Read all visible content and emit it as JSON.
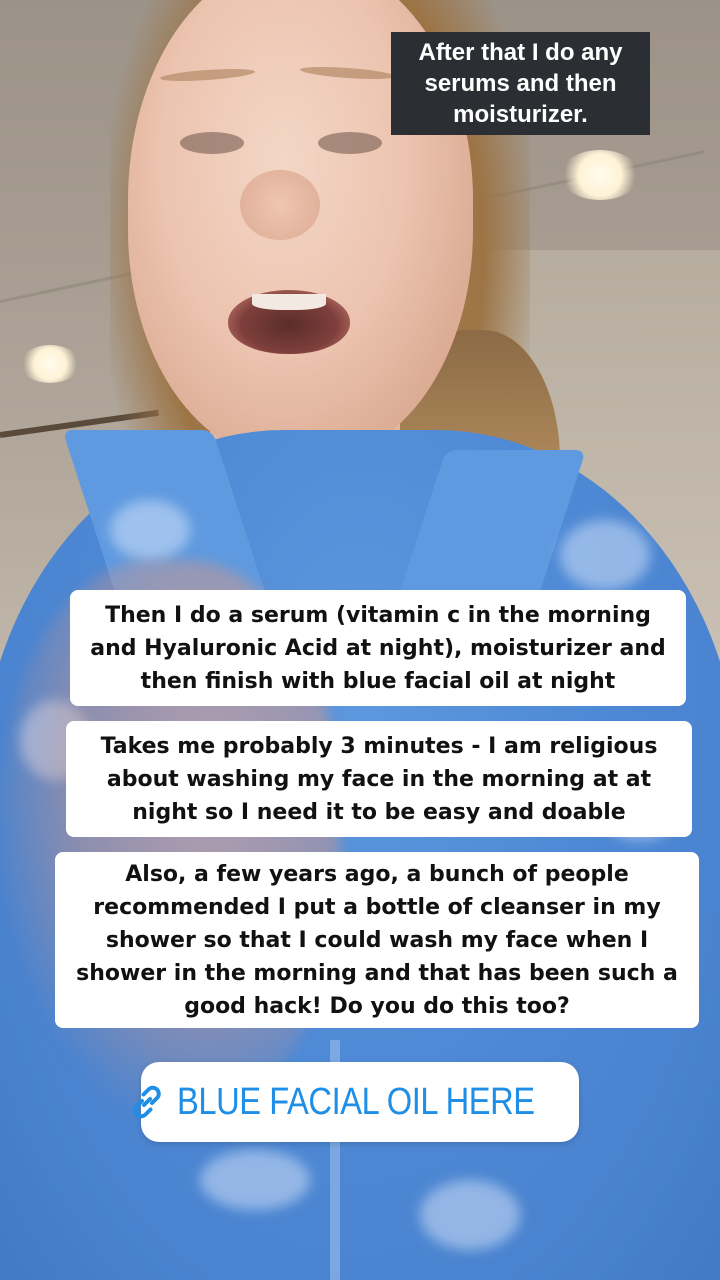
{
  "story": {
    "caption_top": "After that I do any serums and then moisturizer.",
    "text_boxes": [
      "Then I do a serum (vitamin c in the morning and Hyaluronic Acid at night), moisturizer and then finish with blue facial oil at night",
      "Takes me probably 3 minutes - I am religious about washing my face in the morning at at night so I need it to be easy and doable",
      "Also, a few years ago, a bunch of people recommended I put a bottle of cleanser in my shower so that I could wash my face when I shower in the morning and that has been such a good hack! Do you do this too?"
    ],
    "link_sticker": {
      "label": "BLUE FACIAL OIL HERE",
      "icon": "link-icon",
      "color": "#1f8ee6"
    }
  }
}
